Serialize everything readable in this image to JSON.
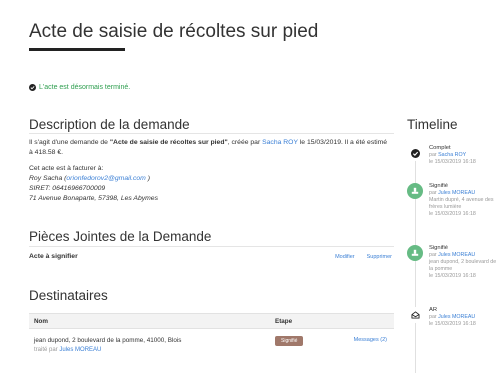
{
  "page": {
    "title": "Acte de saisie de récoltes sur pied"
  },
  "status": {
    "text": "L'acte est désormais terminé.",
    "color": "#2e9e4f"
  },
  "description": {
    "heading": "Description de la demande",
    "intro_1": "Il s'agit d'une demande de ",
    "acte_name": "\"Acte de saisie de récoltes sur pied\"",
    "intro_2": ", créée par ",
    "creator": "Sacha ROY",
    "intro_3": " le 15/03/2019. Il a été estimé à 418.58 €.",
    "facture_label": "Cet acte est à facturer à:",
    "facture_name": "Roy Sacha (",
    "facture_email": "orionfedorov2@gmail.com",
    "facture_name_end": " )",
    "siret": "SIRET: 06416966700009",
    "address": "71 Avenue Bonaparte, 57398, Les Abymes"
  },
  "pieces": {
    "heading": "Pièces Jointes de la Demande",
    "item_label": "Acte à signifier",
    "modify_label": "Modifier",
    "delete_label": "Supprimer"
  },
  "destinataires": {
    "heading": "Destinataires",
    "col_nom": "Nom",
    "col_etape": "Etape",
    "rows": [
      {
        "name": "jean dupond, 2 boulevard de la pomme, 41000, Blois",
        "treated_prefix": "traité par ",
        "treated_by": "Jules MOREAU",
        "etape": "Signifié",
        "messages": "Messages (2)"
      }
    ]
  },
  "timeline": {
    "heading": "Timeline",
    "items": [
      {
        "icon": "check-icon",
        "title": "Complet",
        "by_prefix": "par ",
        "by": "Sacha ROY",
        "extra": "",
        "date": "le 15/03/2019 16:18"
      },
      {
        "icon": "stamp-icon",
        "title": "Signifié",
        "by_prefix": "par ",
        "by": "Jules MOREAU",
        "extra": "Martin dupré, 4 avenue des frères lumière",
        "date": "le 15/03/2019 16:18"
      },
      {
        "icon": "stamp-icon",
        "title": "Signifié",
        "by_prefix": "par ",
        "by": "Jules MOREAU",
        "extra": "jean dupond, 2 boulevard de la pomme",
        "date": "le 15/03/2019 16:18"
      },
      {
        "icon": "envelope-icon",
        "title": "AR",
        "by_prefix": "par ",
        "by": "Jules MOREAU",
        "extra": "",
        "date": "le 15/03/2019 16:18"
      }
    ]
  },
  "colors": {
    "accent": "#3a7fd5",
    "badge": "#a0786a",
    "timeline_green": "#66bb84"
  }
}
